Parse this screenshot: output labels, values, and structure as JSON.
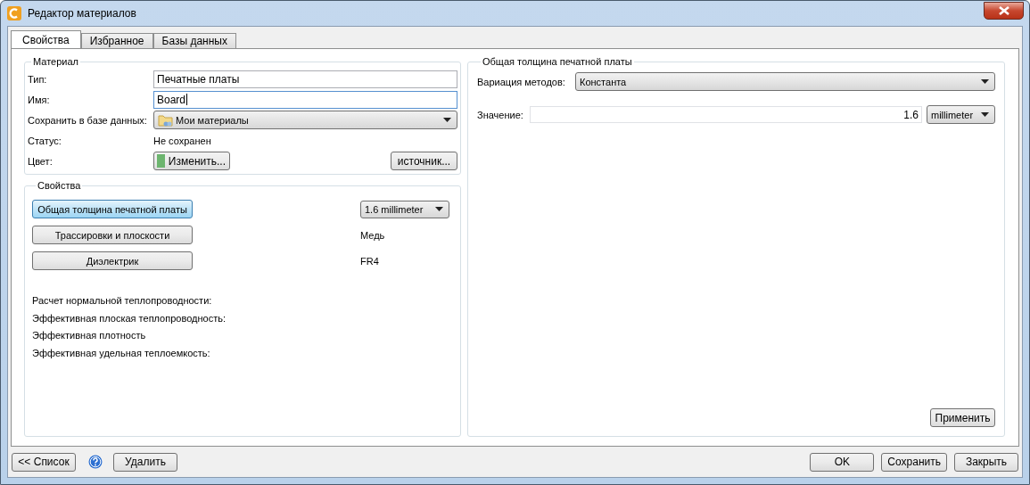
{
  "window": {
    "title": "Редактор материалов"
  },
  "tabs": [
    {
      "label": "Свойства",
      "selected": true
    },
    {
      "label": "Избранное",
      "selected": false
    },
    {
      "label": "Базы данных",
      "selected": false
    }
  ],
  "material": {
    "title": "Материал",
    "type_label": "Тип:",
    "type_value": "Печатные платы",
    "name_label": "Имя:",
    "name_value": "Board",
    "db_label": "Сохранить в базе данных:",
    "db_value": "Мои материалы",
    "status_label": "Статус:",
    "status_value": "Не сохранен",
    "color_label": "Цвет:",
    "color": "#6db56f",
    "color_button": "Изменить...",
    "source_button": "источник..."
  },
  "properties": {
    "title": "Свойства",
    "items": [
      {
        "label": "Общая толщина печатной платы",
        "selected": true,
        "kind": "select",
        "value": "1.6 millimeter"
      },
      {
        "label": "Трассировки и плоскости",
        "selected": false,
        "kind": "text",
        "value": "Медь"
      },
      {
        "label": "Диэлектрик",
        "selected": false,
        "kind": "text",
        "value": "FR4"
      }
    ],
    "info": [
      "Расчет нормальной теплопроводности:",
      "Эффективная плоская теплопроводность:",
      "Эффективная плотность",
      "Эффективная удельная теплоемкость:"
    ]
  },
  "detail": {
    "title": "Общая толщина печатной платы",
    "method_label": "Вариация методов:",
    "method_value": "Константа",
    "value_label": "Значение:",
    "value": "1.6",
    "unit": "millimeter",
    "apply_button": "Применить"
  },
  "footer": {
    "list_button": "<< Список",
    "delete_button": "Удалить",
    "ok_button": "OK",
    "save_button": "Сохранить",
    "close_button": "Закрыть"
  }
}
